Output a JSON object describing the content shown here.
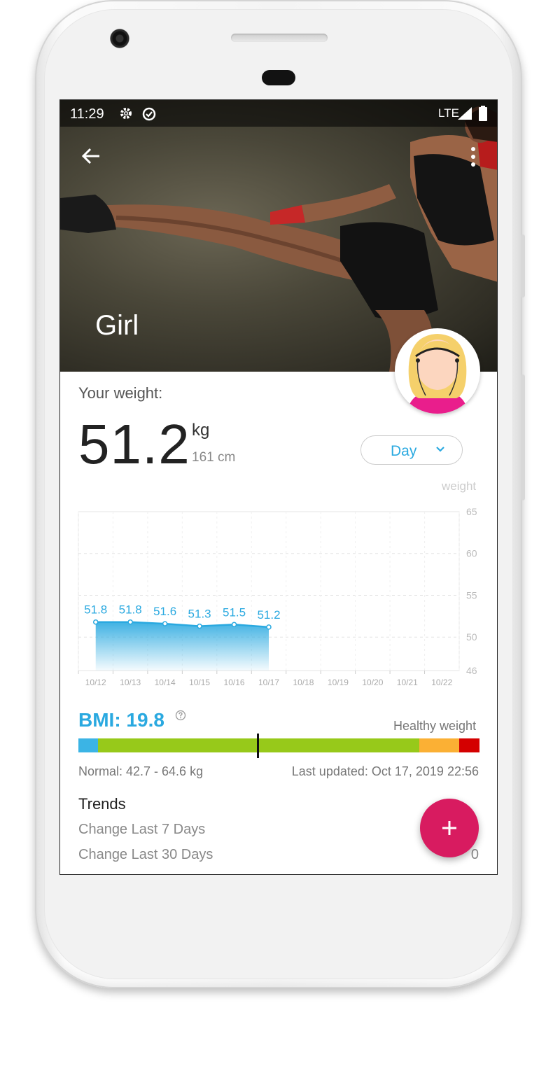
{
  "status_bar": {
    "time": "11:29",
    "network": "LTE"
  },
  "header": {
    "profile_name": "Girl"
  },
  "weight": {
    "label": "Your weight:",
    "value": "51.2",
    "unit": "kg",
    "height": "161 cm"
  },
  "period_select": {
    "selected": "Day"
  },
  "chart_data": {
    "type": "area",
    "legend": "weight",
    "x": [
      "10/12",
      "10/13",
      "10/14",
      "10/15",
      "10/16",
      "10/17",
      "10/18",
      "10/19",
      "10/20",
      "10/21",
      "10/22"
    ],
    "series": [
      {
        "name": "weight",
        "values": [
          51.8,
          51.8,
          51.6,
          51.3,
          51.5,
          51.2,
          null,
          null,
          null,
          null,
          null
        ]
      }
    ],
    "data_labels": [
      "51.8",
      "51.8",
      "51.6",
      "51.3",
      "51.5",
      "51.2"
    ],
    "y_ticks": [
      "65",
      "60",
      "55",
      "50",
      "46"
    ],
    "ylim": [
      46,
      65
    ],
    "y_axis_side": "right",
    "grid": true,
    "color": "#2aa9e0"
  },
  "bmi": {
    "label": "BMI: 19.8",
    "value": 19.8,
    "category": "Healthy weight",
    "normal_range": "Normal: 42.7 - 64.6 kg",
    "last_updated": "Last updated: Oct 17, 2019 22:56",
    "bar_colors": [
      "#3bb4e5",
      "#97c91a",
      "#fbb034",
      "#d40000"
    ]
  },
  "trends": {
    "title": "Trends",
    "rows": [
      {
        "label": "Change Last 7 Days",
        "value": ""
      },
      {
        "label": "Change Last 30 Days",
        "value": "0"
      }
    ]
  },
  "colors": {
    "accent": "#2aa9e0",
    "fab": "#d81b60"
  }
}
